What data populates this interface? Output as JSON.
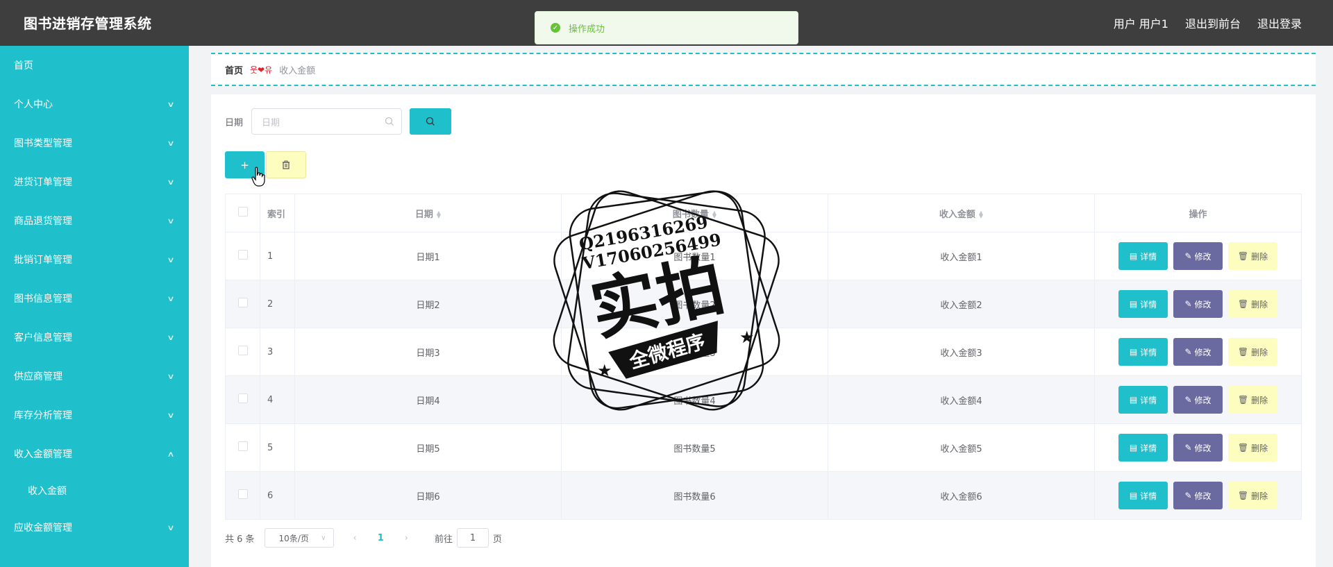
{
  "app": {
    "title": "图书进销存管理系统"
  },
  "header": {
    "user": "用户 用户1",
    "front": "退出到前台",
    "logout": "退出登录"
  },
  "toast": {
    "message": "操作成功"
  },
  "sidebar": {
    "items": [
      {
        "label": "首页"
      },
      {
        "label": "个人中心"
      },
      {
        "label": "图书类型管理"
      },
      {
        "label": "进货订单管理"
      },
      {
        "label": "商品退货管理"
      },
      {
        "label": "批销订单管理"
      },
      {
        "label": "图书信息管理"
      },
      {
        "label": "客户信息管理"
      },
      {
        "label": "供应商管理"
      },
      {
        "label": "库存分析管理"
      },
      {
        "label": "收入金额管理",
        "expanded": true
      },
      {
        "label": "收入金额",
        "sub": true
      },
      {
        "label": "应收金额管理"
      }
    ]
  },
  "breadcrumb": {
    "home": "首页",
    "separator": "웃❤유",
    "current": "收入金额"
  },
  "search": {
    "label": "日期",
    "placeholder": "日期"
  },
  "table": {
    "headers": {
      "index": "索引",
      "date": "日期",
      "qty": "图书数量",
      "amount": "收入金额",
      "ops": "操作"
    },
    "rows": [
      {
        "index": "1",
        "date": "日期1",
        "qty": "图书数量1",
        "amount": "收入金额1"
      },
      {
        "index": "2",
        "date": "日期2",
        "qty": "图书数量2",
        "amount": "收入金额2"
      },
      {
        "index": "3",
        "date": "日期3",
        "qty": "图书数量3",
        "amount": "收入金额3"
      },
      {
        "index": "4",
        "date": "日期4",
        "qty": "图书数量4",
        "amount": "收入金额4"
      },
      {
        "index": "5",
        "date": "日期5",
        "qty": "图书数量5",
        "amount": "收入金额5"
      },
      {
        "index": "6",
        "date": "日期6",
        "qty": "图书数量6",
        "amount": "收入金额6"
      }
    ],
    "ops": {
      "detail": "详情",
      "edit": "修改",
      "remove": "删除"
    }
  },
  "pagination": {
    "total": "共 6 条",
    "page_size": "10条/页",
    "current": "1",
    "goto_prefix": "前往",
    "goto_value": "1",
    "goto_suffix": "页"
  },
  "watermark": {
    "line1": "Q2196316269",
    "line2": "V17060256499",
    "main": "实拍",
    "banner": "全微程序"
  },
  "colors": {
    "accent": "#1fbfcb",
    "topbar": "#3e3e3e",
    "edit": "#6b6aa0",
    "remove": "#fdfdc0",
    "success": "#67c23a"
  }
}
